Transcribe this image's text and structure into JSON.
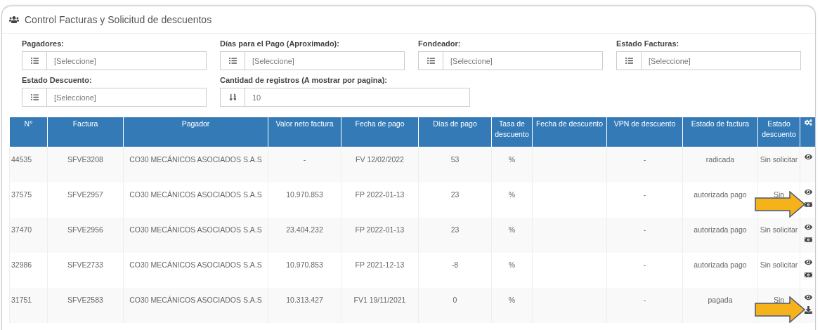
{
  "panel": {
    "title": "Control Facturas y Solicitud de descuentos"
  },
  "filters": [
    {
      "label": "Pagadores:",
      "kind": "select",
      "placeholder": "[Seleccione]"
    },
    {
      "label": "Días para el Pago (Aproximado):",
      "kind": "select",
      "placeholder": "[Seleccione]"
    },
    {
      "label": "Fondeador:",
      "kind": "select",
      "placeholder": "[Seleccione]"
    },
    {
      "label": "Estado Facturas:",
      "kind": "select",
      "placeholder": "[Seleccione]"
    },
    {
      "label": "Estado Descuento:",
      "kind": "select",
      "placeholder": "[Seleccione]"
    },
    {
      "label": "Cantidad de registros (A mostrar por pagina):",
      "kind": "count",
      "value": "10"
    }
  ],
  "table": {
    "columns": [
      "N°",
      "Factura",
      "Pagador",
      "Valor neto factura",
      "Fecha de pago",
      "Días de pago",
      "Tasa de descuento",
      "Fecha de descuento",
      "VPN de descuento",
      "Estado de factura",
      "Estado descuento"
    ],
    "rows": [
      {
        "cells": [
          "44535",
          "SFVE3208",
          "CO30 MECÁNICOS ASOCIADOS S.A.S",
          "-",
          "FV 12/02/2022",
          "53",
          "%",
          "",
          "-",
          "radicada",
          "Sin solicitar"
        ],
        "actions": [
          {
            "kind": "view"
          }
        ],
        "arrow": false
      },
      {
        "cells": [
          "37575",
          "SFVE2957",
          "CO30 MECÁNICOS ASOCIADOS S.A.S",
          "10.970.853",
          "FP 2022-01-13",
          "23",
          "%",
          "",
          "-",
          "autorizada pago",
          "Sin"
        ],
        "actions": [
          {
            "kind": "view"
          },
          {
            "kind": "money"
          }
        ],
        "arrow": true
      },
      {
        "cells": [
          "37470",
          "SFVE2956",
          "CO30 MECÁNICOS ASOCIADOS S.A.S",
          "23.404.232",
          "FP 2022-01-13",
          "23",
          "%",
          "",
          "-",
          "autorizada pago",
          "Sin solicitar"
        ],
        "actions": [
          {
            "kind": "view"
          },
          {
            "kind": "money"
          }
        ],
        "arrow": false
      },
      {
        "cells": [
          "32986",
          "SFVE2733",
          "CO30 MECÁNICOS ASOCIADOS S.A.S",
          "10.970.853",
          "FP 2021-12-13",
          "-8",
          "%",
          "",
          "-",
          "autorizada pago",
          "Sin solicitar"
        ],
        "actions": [
          {
            "kind": "view"
          },
          {
            "kind": "money"
          }
        ],
        "arrow": false
      },
      {
        "cells": [
          "31751",
          "SFVE2583",
          "CO30 MECÁNICOS ASOCIADOS S.A.S",
          "10.313.427",
          "FV1 19/11/2021",
          "0",
          "%",
          "",
          "-",
          "pagada",
          "Sin"
        ],
        "actions": [
          {
            "kind": "view"
          },
          {
            "kind": "download"
          }
        ],
        "arrow": true
      }
    ]
  }
}
